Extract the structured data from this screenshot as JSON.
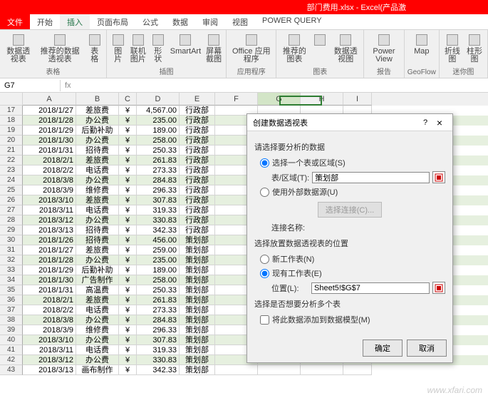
{
  "title": "部门费用.xlsx - Excel(产品激",
  "tabs": {
    "file": "文件",
    "home": "开始",
    "insert": "插入",
    "layout": "页面布局",
    "formula": "公式",
    "data": "数据",
    "review": "审阅",
    "view": "视图",
    "pq": "POWER QUERY"
  },
  "ribbon_groups": {
    "tables": {
      "items": [
        "数据透视表",
        "推荐的数据透视表",
        "表格"
      ],
      "label": "表格"
    },
    "illus": {
      "items": [
        "图片",
        "联机图片",
        "形状",
        "SmartArt",
        "屏幕截图"
      ],
      "label": "插图"
    },
    "apps": {
      "items": [
        "Office 应用程序"
      ],
      "label": "应用程序"
    },
    "charts": {
      "items": [
        "推荐的图表",
        "",
        "数据透视图"
      ],
      "label": "图表"
    },
    "reports": {
      "items": [
        "Power View"
      ],
      "label": "报告"
    },
    "geo": {
      "items": [
        "Map"
      ],
      "label": "GeoFlow"
    },
    "spark": {
      "items": [
        "折线图",
        "柱形图"
      ],
      "label": "迷你图"
    }
  },
  "namebox": "G7",
  "col_widths": {
    "A": 75,
    "B": 60,
    "C": 25,
    "D": 60,
    "E": 50,
    "F": 60,
    "G": 60,
    "H": 60,
    "I": 40
  },
  "cols": [
    "A",
    "B",
    "C",
    "D",
    "E",
    "F",
    "G",
    "H",
    "I"
  ],
  "rows": [
    {
      "n": 17,
      "d": "2018/1/27",
      "t": "差旅费",
      "s": "¥",
      "a": "4,567.00",
      "dep": "行政部"
    },
    {
      "n": 18,
      "d": "2018/1/28",
      "t": "办公费",
      "s": "¥",
      "a": "235.00",
      "dep": "行政部"
    },
    {
      "n": 19,
      "d": "2018/1/29",
      "t": "后勤补助",
      "s": "¥",
      "a": "189.00",
      "dep": "行政部"
    },
    {
      "n": 20,
      "d": "2018/1/30",
      "t": "办公费",
      "s": "¥",
      "a": "258.00",
      "dep": "行政部"
    },
    {
      "n": 21,
      "d": "2018/1/31",
      "t": "招待费",
      "s": "¥",
      "a": "250.33",
      "dep": "行政部"
    },
    {
      "n": 22,
      "d": "2018/2/1",
      "t": "差旅费",
      "s": "¥",
      "a": "261.83",
      "dep": "行政部"
    },
    {
      "n": 23,
      "d": "2018/2/2",
      "t": "电话费",
      "s": "¥",
      "a": "273.33",
      "dep": "行政部"
    },
    {
      "n": 24,
      "d": "2018/3/8",
      "t": "办公费",
      "s": "¥",
      "a": "284.83",
      "dep": "行政部"
    },
    {
      "n": 25,
      "d": "2018/3/9",
      "t": "维修费",
      "s": "¥",
      "a": "296.33",
      "dep": "行政部"
    },
    {
      "n": 26,
      "d": "2018/3/10",
      "t": "差旅费",
      "s": "¥",
      "a": "307.83",
      "dep": "行政部"
    },
    {
      "n": 27,
      "d": "2018/3/11",
      "t": "电话费",
      "s": "¥",
      "a": "319.33",
      "dep": "行政部"
    },
    {
      "n": 28,
      "d": "2018/3/12",
      "t": "办公费",
      "s": "¥",
      "a": "330.83",
      "dep": "行政部"
    },
    {
      "n": 29,
      "d": "2018/3/13",
      "t": "招待费",
      "s": "¥",
      "a": "342.33",
      "dep": "行政部"
    },
    {
      "n": 30,
      "d": "2018/1/26",
      "t": "招待费",
      "s": "¥",
      "a": "456.00",
      "dep": "策划部"
    },
    {
      "n": 31,
      "d": "2018/1/27",
      "t": "差旅费",
      "s": "¥",
      "a": "259.00",
      "dep": "策划部"
    },
    {
      "n": 32,
      "d": "2018/1/28",
      "t": "办公费",
      "s": "¥",
      "a": "235.00",
      "dep": "策划部"
    },
    {
      "n": 33,
      "d": "2018/1/29",
      "t": "后勤补助",
      "s": "¥",
      "a": "189.00",
      "dep": "策划部"
    },
    {
      "n": 34,
      "d": "2018/1/30",
      "t": "广告制作",
      "s": "¥",
      "a": "258.00",
      "dep": "策划部"
    },
    {
      "n": 35,
      "d": "2018/1/31",
      "t": "高温费",
      "s": "¥",
      "a": "250.33",
      "dep": "策划部"
    },
    {
      "n": 36,
      "d": "2018/2/1",
      "t": "差旅费",
      "s": "¥",
      "a": "261.83",
      "dep": "策划部"
    },
    {
      "n": 37,
      "d": "2018/2/2",
      "t": "电话费",
      "s": "¥",
      "a": "273.33",
      "dep": "策划部"
    },
    {
      "n": 38,
      "d": "2018/3/8",
      "t": "办公费",
      "s": "¥",
      "a": "284.83",
      "dep": "策划部"
    },
    {
      "n": 39,
      "d": "2018/3/9",
      "t": "维修费",
      "s": "¥",
      "a": "296.33",
      "dep": "策划部"
    },
    {
      "n": 40,
      "d": "2018/3/10",
      "t": "办公费",
      "s": "¥",
      "a": "307.83",
      "dep": "策划部"
    },
    {
      "n": 41,
      "d": "2018/3/11",
      "t": "电话费",
      "s": "¥",
      "a": "319.33",
      "dep": "策划部"
    },
    {
      "n": 42,
      "d": "2018/3/12",
      "t": "办公费",
      "s": "¥",
      "a": "330.83",
      "dep": "策划部"
    },
    {
      "n": 43,
      "d": "2018/3/13",
      "t": "画布制作",
      "s": "¥",
      "a": "342.33",
      "dep": "策划部"
    }
  ],
  "dialog": {
    "title": "创建数据透视表",
    "sec1": "请选择要分析的数据",
    "r1": "选择一个表或区域(S)",
    "f1_label": "表/区域(T):",
    "f1_value": "策划部",
    "r2": "使用外部数据源(U)",
    "btn_disabled": "选择连接(C)...",
    "conn_label": "连接名称:",
    "sec2": "选择放置数据透视表的位置",
    "r3": "新工作表(N)",
    "r4": "现有工作表(E)",
    "f2_label": "位置(L):",
    "f2_value": "Sheet5!$G$7",
    "sec3": "选择是否想要分析多个表",
    "chk": "将此数据添加到数据模型(M)",
    "ok": "确定",
    "cancel": "取消"
  },
  "watermark": "www.xfari.com"
}
